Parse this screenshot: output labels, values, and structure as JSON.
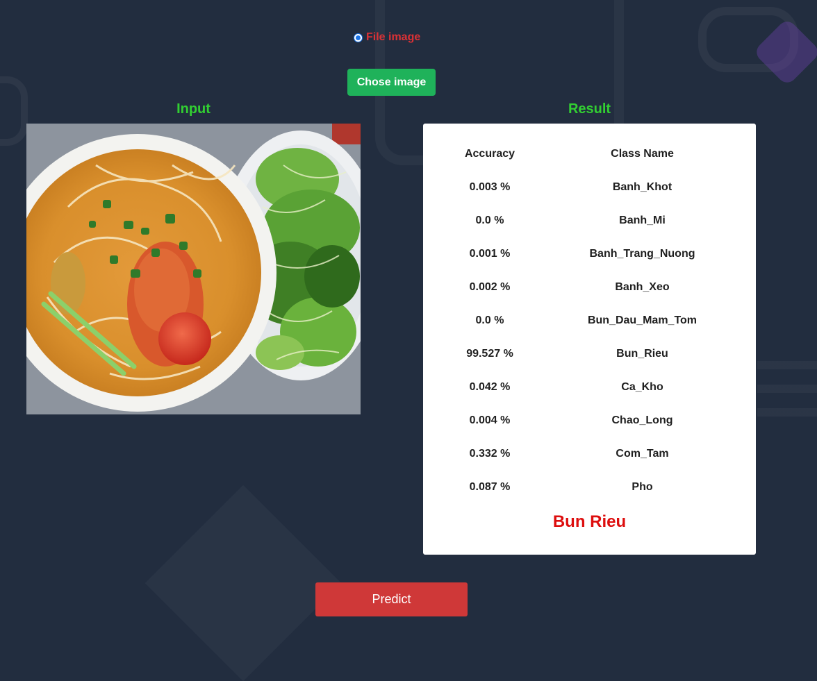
{
  "source": {
    "option_label": "File image",
    "selected": true
  },
  "upload": {
    "button_label": "Chose image"
  },
  "input": {
    "heading": "Input"
  },
  "result": {
    "heading": "Result",
    "columns": {
      "accuracy": "Accuracy",
      "class_name": "Class Name"
    },
    "rows": [
      {
        "accuracy": "0.003 %",
        "class_name": "Banh_Khot"
      },
      {
        "accuracy": "0.0 %",
        "class_name": "Banh_Mi"
      },
      {
        "accuracy": "0.001 %",
        "class_name": "Banh_Trang_Nuong"
      },
      {
        "accuracy": "0.002 %",
        "class_name": "Banh_Xeo"
      },
      {
        "accuracy": "0.0 %",
        "class_name": "Bun_Dau_Mam_Tom"
      },
      {
        "accuracy": "99.527 %",
        "class_name": "Bun_Rieu"
      },
      {
        "accuracy": "0.042 %",
        "class_name": "Ca_Kho"
      },
      {
        "accuracy": "0.004 %",
        "class_name": "Chao_Long"
      },
      {
        "accuracy": "0.332 %",
        "class_name": "Com_Tam"
      },
      {
        "accuracy": "0.087 %",
        "class_name": "Pho"
      }
    ],
    "prediction": "Bun Rieu"
  },
  "actions": {
    "predict_label": "Predict"
  },
  "colors": {
    "background": "#222d3f",
    "heading_green": "#32cf32",
    "radio_label_red": "#dc3135",
    "upload_green": "#1fb25a",
    "prediction_red": "#dd0e0e",
    "predict_button_red": "#cf3838"
  }
}
